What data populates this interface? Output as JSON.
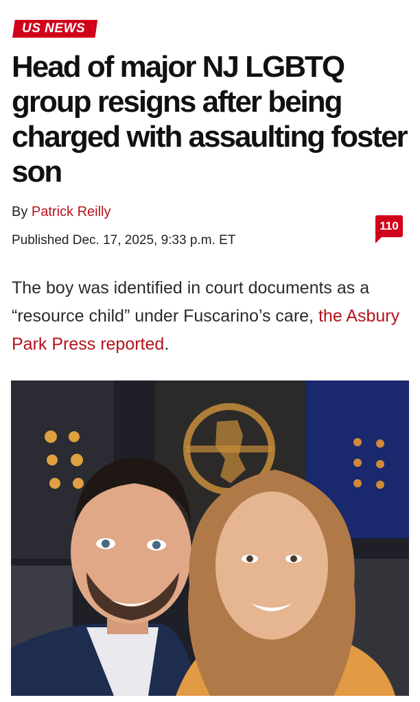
{
  "section_tag": "US NEWS",
  "headline": "Head of major NJ LGBTQ group resigns after being charged with assaulting foster son",
  "byline": {
    "prefix": "By",
    "author": "Patrick Reilly"
  },
  "published": "Published Dec. 17, 2025, 9:33 p.m. ET",
  "comment_count": "110",
  "summary": {
    "text_before": "The boy was identified in court documents as a “resource child” under Fuscarino’s care,",
    "link_text": "the Asbury Park Press reported",
    "text_after": "."
  },
  "photo": {
    "description_icon": "photo-of-two-people-icon"
  },
  "colors": {
    "accent": "#d0021b",
    "link": "#b5121b"
  }
}
